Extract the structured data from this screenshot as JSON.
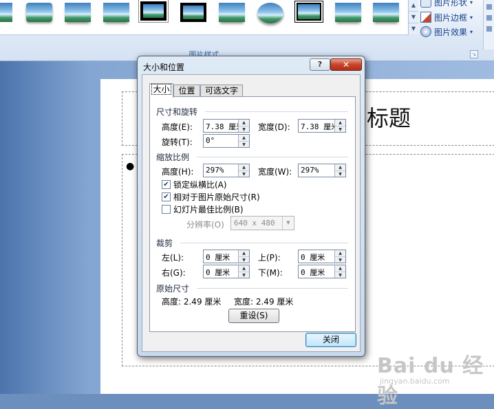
{
  "ribbon": {
    "thumbnail_styles": [
      "simple-frame",
      "soft-edge",
      "soft-shadow",
      "drop-shadow",
      "white-thick-frame",
      "black-frame",
      "reflected",
      "oval",
      "double-black-frame",
      "soft-reflection",
      "rotated"
    ],
    "commands": [
      {
        "label": "图片形状",
        "icon": "shape-icon"
      },
      {
        "label": "图片边框",
        "icon": "border-pen-icon"
      },
      {
        "label": "图片效果",
        "icon": "effects-icon"
      }
    ],
    "group_label": "图片样式",
    "accent": "#15428b"
  },
  "slide": {
    "title_text": "标题",
    "bullet": "●"
  },
  "watermark": {
    "brand": "Bai du 经验",
    "url": "jingyan.baidu.com"
  },
  "dialog": {
    "title": "大小和位置",
    "help_label": "?",
    "close_x": "✕",
    "tabs": [
      "大小",
      "位置",
      "可选文字"
    ],
    "active_tab": 0,
    "size_rotate": {
      "heading": "尺寸和旋转",
      "height_label": "高度(E):",
      "height_value": "7.38 厘米",
      "width_label": "宽度(D):",
      "width_value": "7.38 厘米",
      "rotation_label": "旋转(T):",
      "rotation_value": "0°"
    },
    "scale": {
      "heading": "缩放比例",
      "height_label": "高度(H):",
      "height_value": "297%",
      "width_label": "宽度(W):",
      "width_value": "297%",
      "lock_aspect": {
        "label": "锁定纵横比(A)",
        "checked": true
      },
      "relative_original": {
        "label": "相对于图片原始尺寸(R)",
        "checked": true
      },
      "best_scale": {
        "label": "幻灯片最佳比例(B)",
        "checked": false
      },
      "resolution_label": "分辨率(O)",
      "resolution_value": "640 x 480"
    },
    "crop": {
      "heading": "裁剪",
      "left_label": "左(L):",
      "left_value": "0 厘米",
      "top_label": "上(P):",
      "top_value": "0 厘米",
      "right_label": "右(G):",
      "right_value": "0 厘米",
      "bottom_label": "下(M):",
      "bottom_value": "0 厘米"
    },
    "original": {
      "heading": "原始尺寸",
      "height_text": "高度:  2.49 厘米",
      "width_text": "宽度:  2.49 厘米",
      "reset_label": "重设(S)"
    },
    "close_label": "关闭"
  }
}
